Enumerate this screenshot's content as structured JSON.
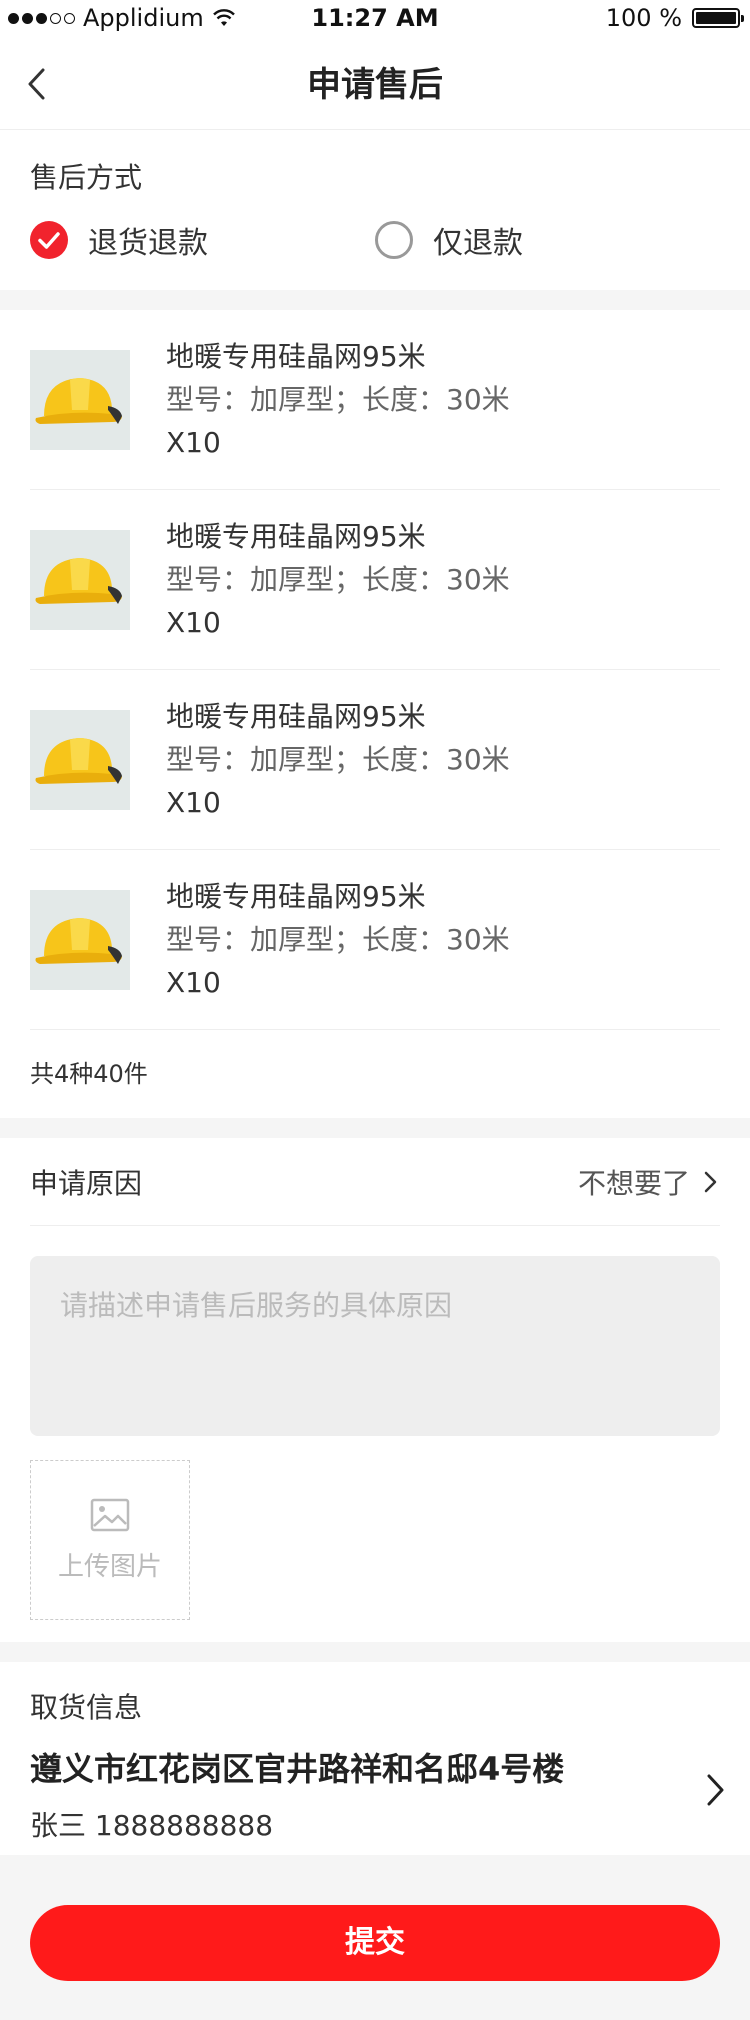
{
  "status_bar": {
    "carrier": "Applidium",
    "time": "11:27 AM",
    "battery": "100 %",
    "signal_icon": "signal-dots-icon",
    "wifi_icon": "wifi-icon",
    "battery_icon": "battery-icon"
  },
  "nav": {
    "title": "申请售后",
    "back_icon": "chevron-left-icon"
  },
  "method": {
    "label": "售后方式",
    "options": [
      {
        "label": "退货退款",
        "checked": true
      },
      {
        "label": "仅退款",
        "checked": false
      }
    ]
  },
  "products": {
    "items": [
      {
        "name": "地暖专用硅晶网95米",
        "spec": "型号：加厚型；长度：30米",
        "qty": "X10",
        "image": "yellow-helmet-image"
      },
      {
        "name": "地暖专用硅晶网95米",
        "spec": "型号：加厚型；长度：30米",
        "qty": "X10",
        "image": "yellow-helmet-image"
      },
      {
        "name": "地暖专用硅晶网95米",
        "spec": "型号：加厚型；长度：30米",
        "qty": "X10",
        "image": "yellow-helmet-image"
      },
      {
        "name": "地暖专用硅晶网95米",
        "spec": "型号：加厚型；长度：30米",
        "qty": "X10",
        "image": "yellow-helmet-image"
      }
    ],
    "total": "共4种40件"
  },
  "reason": {
    "label": "申请原因",
    "value": "不想要了",
    "placeholder": "请描述申请售后服务的具体原因",
    "upload_label": "上传图片",
    "upload_icon": "image-icon"
  },
  "pickup": {
    "label": "取货信息",
    "address": "遵义市红花岗区官井路祥和名邸4号楼",
    "contact": "张三 1888888888"
  },
  "submit_label": "提交",
  "colors": {
    "accent": "#ff1a1a",
    "check": "#f1232d"
  }
}
